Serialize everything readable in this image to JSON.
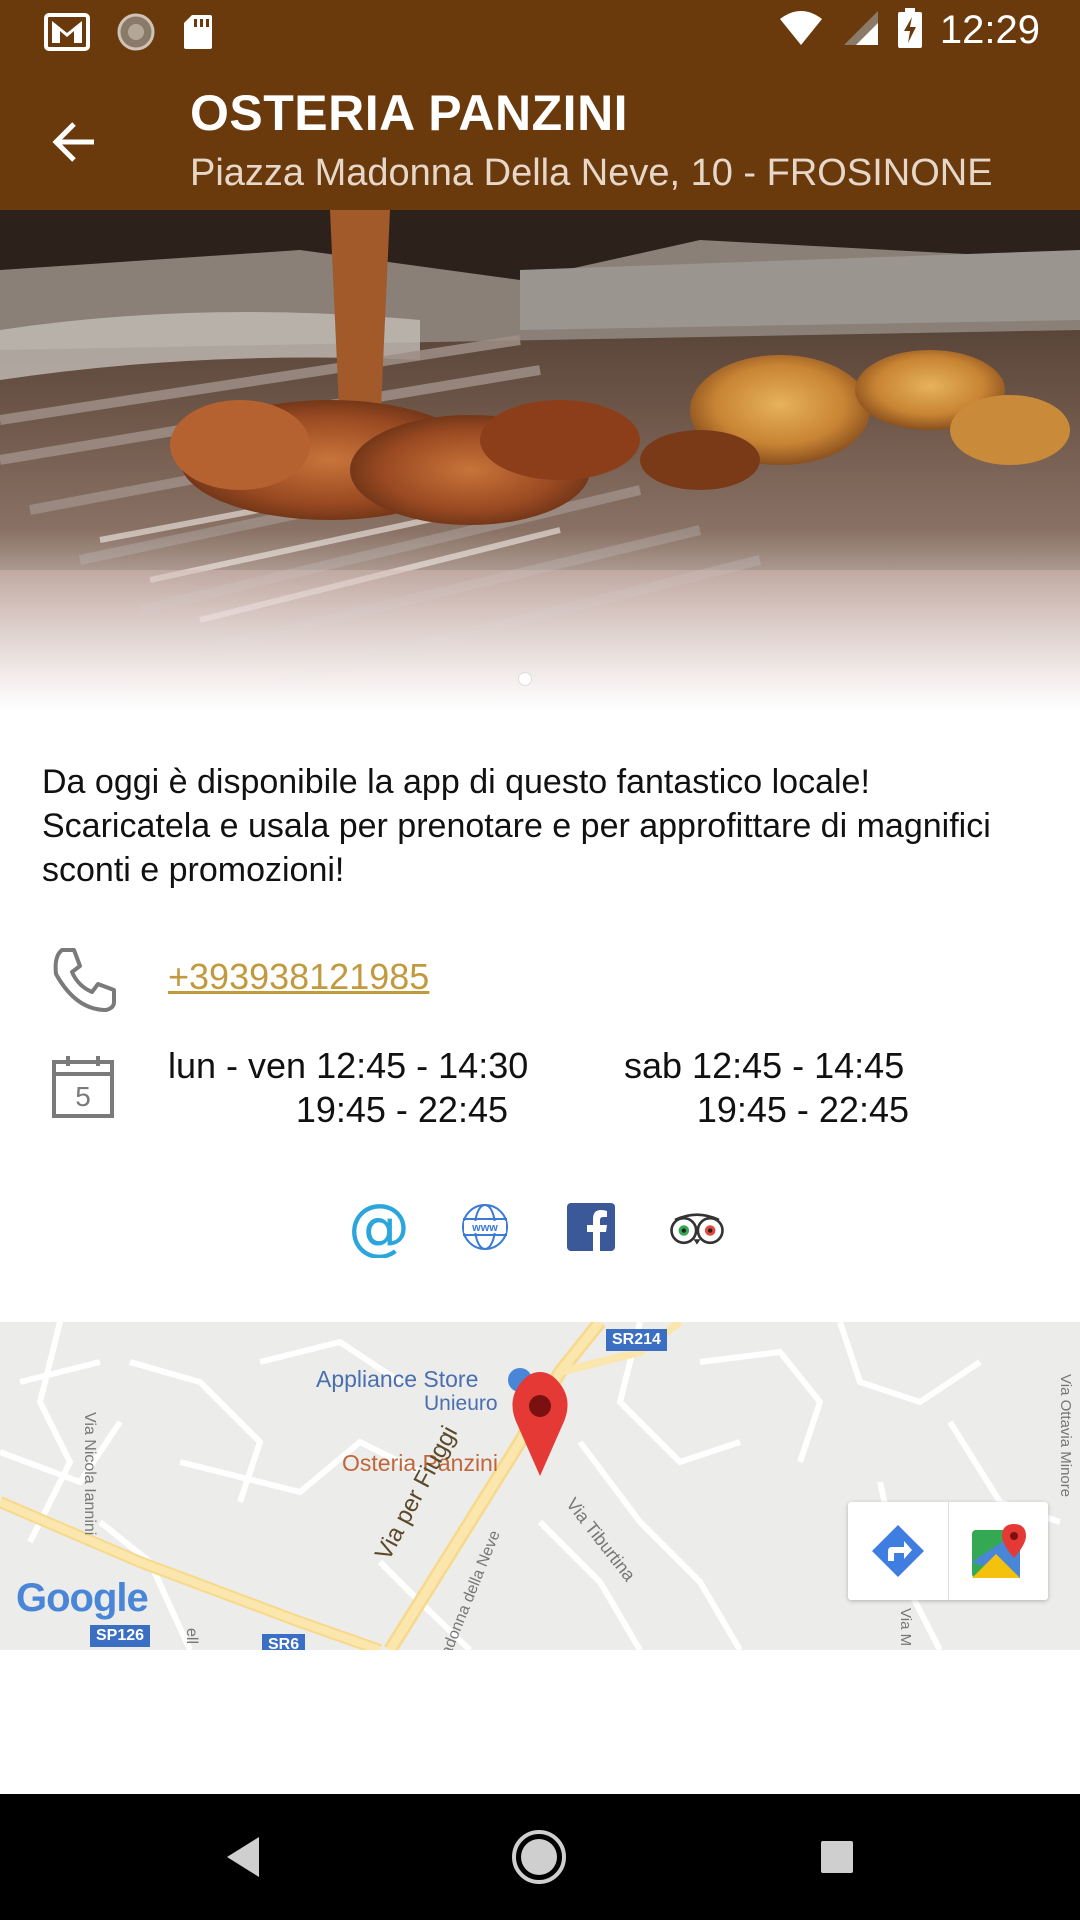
{
  "status_bar": {
    "time": "12:29",
    "icons": [
      "gmail-icon",
      "sync-icon",
      "sd-card-icon",
      "wifi-icon",
      "signal-icon",
      "battery-charging-icon"
    ]
  },
  "app_bar": {
    "title": "OSTERIA PANZINI",
    "subtitle": "Piazza Madonna Della Neve, 10 - FROSINONE"
  },
  "description": "Da oggi è disponibile la app di questo fantastico locale! Scaricatela e usala per prenotare e per approfittare di magnifici sconti e promozioni!",
  "contact": {
    "phone": "+393938121985"
  },
  "hours": {
    "weekdays_label_line1": "lun - ven 12:45 - 14:30",
    "weekdays_line2": "19:45 - 22:45",
    "saturday_line1": "sab 12:45 - 14:45",
    "saturday_line2": "19:45 - 22:45"
  },
  "social": {
    "icons": [
      "email-icon",
      "website-icon",
      "facebook-icon",
      "tripadvisor-icon"
    ]
  },
  "map": {
    "labels": {
      "appliance_store": "Appliance Store",
      "unieuro": "Unieuro",
      "osteria": "Osteria Panzini",
      "via_fiuggi": "Via per Fiuggi",
      "via_madonna": "adonna della Neve",
      "via_tiburtina": "Via Tiburtina",
      "via_nicola": "Via Nicola Iannini",
      "via_ottavia": "Via Ottavia Minore",
      "via_m": "Via M",
      "ell": "ell",
      "sr214": "SR214",
      "sp126": "SP126",
      "sr6": "SR6",
      "google": "Google"
    }
  },
  "colors": {
    "app_bar": "#6b3a0c",
    "link": "#c29a3e",
    "map_pin": "#e53935"
  }
}
